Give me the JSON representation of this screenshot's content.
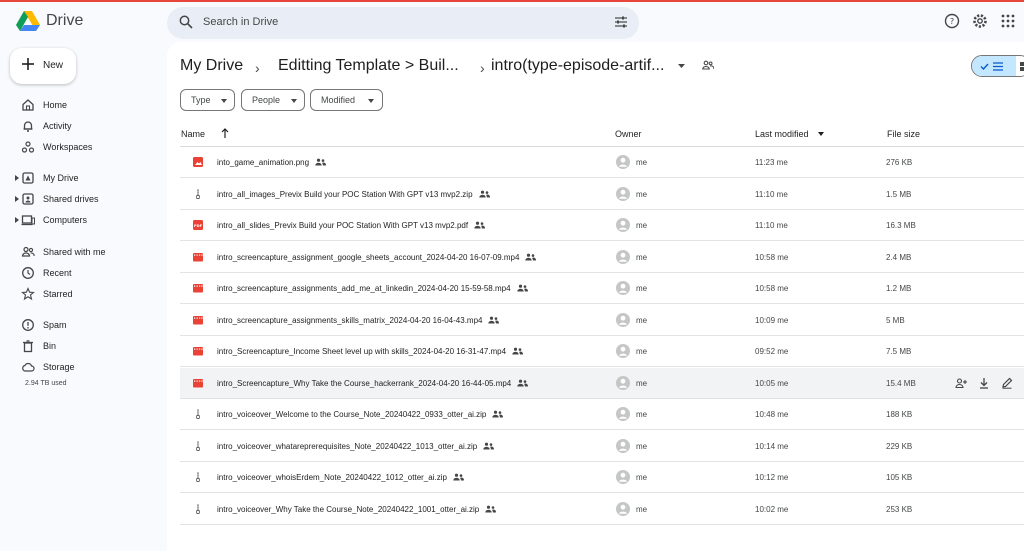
{
  "app": {
    "name": "Drive"
  },
  "colors": {
    "accent": "#0b57d0",
    "selected": "#c2e7ff",
    "red_file": "#ea4335"
  },
  "search": {
    "placeholder": "Search in Drive"
  },
  "header_icons": [
    "help-icon",
    "settings-icon",
    "apps-grid-icon"
  ],
  "sidebar": {
    "new_label": "New",
    "items": [
      {
        "label": "Home",
        "icon": "home-icon"
      },
      {
        "label": "Activity",
        "icon": "bell-icon"
      },
      {
        "label": "Workspaces",
        "icon": "workspaces-icon"
      },
      {
        "label": "My Drive",
        "icon": "my-drive-icon"
      },
      {
        "label": "Shared drives",
        "icon": "shared-drives-icon"
      },
      {
        "label": "Computers",
        "icon": "computer-icon"
      },
      {
        "label": "Shared with me",
        "icon": "people-icon"
      },
      {
        "label": "Recent",
        "icon": "clock-icon"
      },
      {
        "label": "Starred",
        "icon": "star-icon"
      },
      {
        "label": "Spam",
        "icon": "spam-icon"
      },
      {
        "label": "Bin",
        "icon": "bin-icon"
      },
      {
        "label": "Storage",
        "icon": "cloud-icon"
      }
    ],
    "storage_used": "2.94 TB used"
  },
  "breadcrumb": {
    "root": "My Drive",
    "middle": "Editting Template > Buil...",
    "current": "intro(type-episode-artif..."
  },
  "filters": [
    "Type",
    "People",
    "Modified"
  ],
  "columns": {
    "name": "Name",
    "owner": "Owner",
    "modified": "Last modified",
    "size": "File size"
  },
  "files": [
    {
      "name": "into_game_animation.png",
      "type": "image",
      "owner": "me",
      "modified": "11:23 me",
      "size": "276 KB"
    },
    {
      "name": "intro_all_images_Previx  Build your  POC Station With GPT v13   mvp2.zip",
      "type": "zip",
      "owner": "me",
      "modified": "11:10 me",
      "size": "1.5 MB"
    },
    {
      "name": "intro_all_slides_Previx  Build your  POC Station With GPT v13   mvp2.pdf",
      "type": "pdf",
      "owner": "me",
      "modified": "11:10 me",
      "size": "16.3 MB"
    },
    {
      "name": "intro_screencapture_assignment_google_sheets_account_2024-04-20 16-07-09.mp4",
      "type": "video",
      "owner": "me",
      "modified": "10:58 me",
      "size": "2.4 MB"
    },
    {
      "name": "intro_screencapture_assignments_add_me_at_linkedin_2024-04-20 15-59-58.mp4",
      "type": "video",
      "owner": "me",
      "modified": "10:58 me",
      "size": "1.2 MB"
    },
    {
      "name": "intro_screencapture_assignments_skills_matrix_2024-04-20 16-04-43.mp4",
      "type": "video",
      "owner": "me",
      "modified": "10:09 me",
      "size": "5 MB"
    },
    {
      "name": "intro_Screencapture_Income Sheet level up with skills_2024-04-20 16-31-47.mp4",
      "type": "video",
      "owner": "me",
      "modified": "09:52 me",
      "size": "7.5 MB"
    },
    {
      "name": "intro_Screencapture_Why Take the Course_hackerrank_2024-04-20 16-44-05.mp4",
      "type": "video",
      "owner": "me",
      "modified": "10:05 me",
      "size": "15.4 MB"
    },
    {
      "name": "intro_voiceover_Welcome to the Course_Note_20240422_0933_otter_ai.zip",
      "type": "zip",
      "owner": "me",
      "modified": "10:48 me",
      "size": "188 KB"
    },
    {
      "name": "intro_voiceover_whatareprerequisites_Note_20240422_1013_otter_ai.zip",
      "type": "zip",
      "owner": "me",
      "modified": "10:14 me",
      "size": "229 KB"
    },
    {
      "name": "intro_voiceover_whoisErdem_Note_20240422_1012_otter_ai.zip",
      "type": "zip",
      "owner": "me",
      "modified": "10:12 me",
      "size": "105 KB"
    },
    {
      "name": "intro_voiceover_Why Take the Course_Note_20240422_1001_otter_ai.zip",
      "type": "zip",
      "owner": "me",
      "modified": "10:02 me",
      "size": "253 KB"
    }
  ],
  "row_actions": [
    "share-icon",
    "download-icon",
    "rename-icon"
  ]
}
